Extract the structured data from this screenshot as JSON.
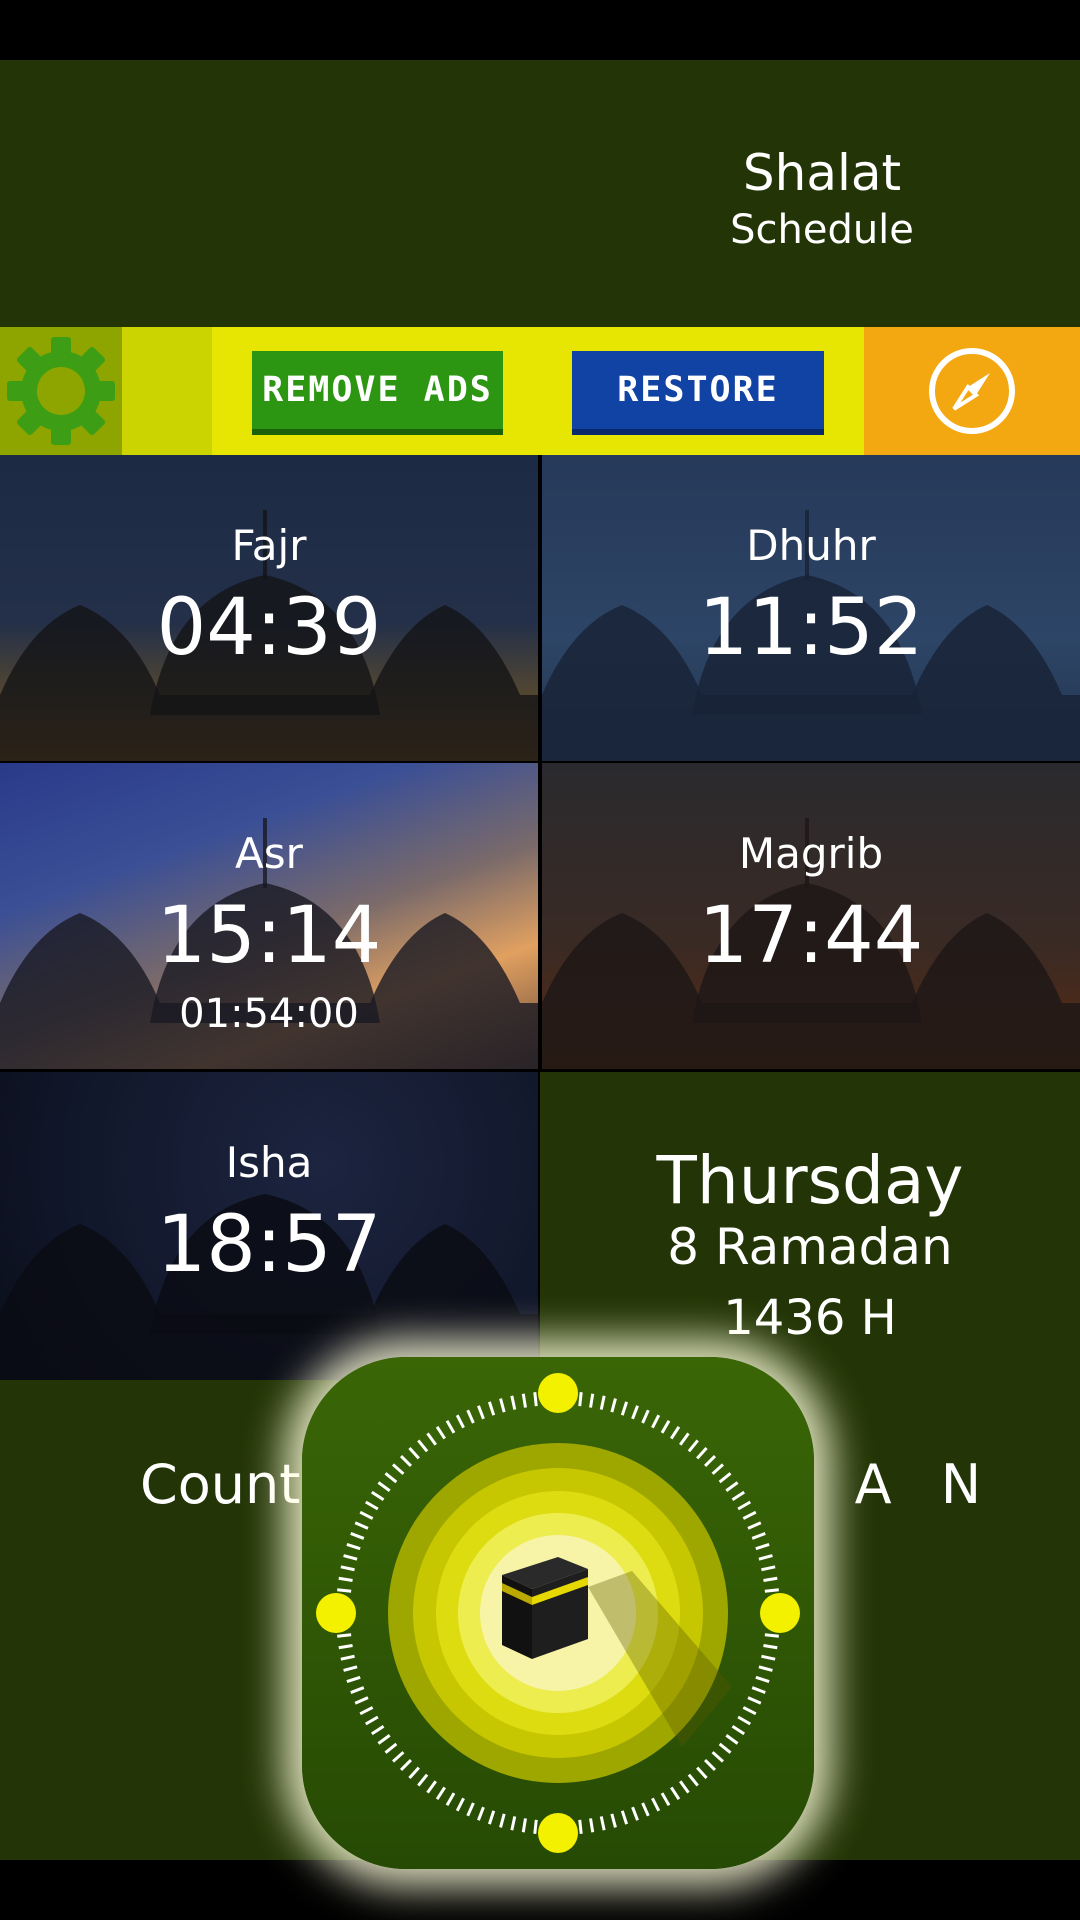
{
  "header": {
    "title_line1": "Shalat",
    "title_line2": "Schedule"
  },
  "toolbar": {
    "settings_icon": "gear-icon",
    "remove_ads_label": "REMOVE ADS",
    "restore_label": "RESTORE",
    "compass_icon": "compass-icon"
  },
  "prayers": [
    {
      "name": "Fajr",
      "time": "04:39"
    },
    {
      "name": "Dhuhr",
      "time": "11:52"
    },
    {
      "name": "Asr",
      "time": "15:14",
      "countdown": "01:54:00"
    },
    {
      "name": "Magrib",
      "time": "17:44"
    },
    {
      "name": "Isha",
      "time": "18:57"
    }
  ],
  "date": {
    "day": "Thursday",
    "hijri_date": "8 Ramadan",
    "hijri_year": "1436 H"
  },
  "bottom": {
    "left_label": "Count",
    "right_label": "R A N"
  },
  "overlay": {
    "icon": "kaaba-qibla-app-icon"
  },
  "colors": {
    "background_green": "#233506",
    "toolbar_yellow": "#e6e602",
    "remove_ads_green": "#2c9613",
    "restore_blue": "#1043a3",
    "compass_orange": "#f3a711",
    "settings_green": "#8ea500"
  }
}
